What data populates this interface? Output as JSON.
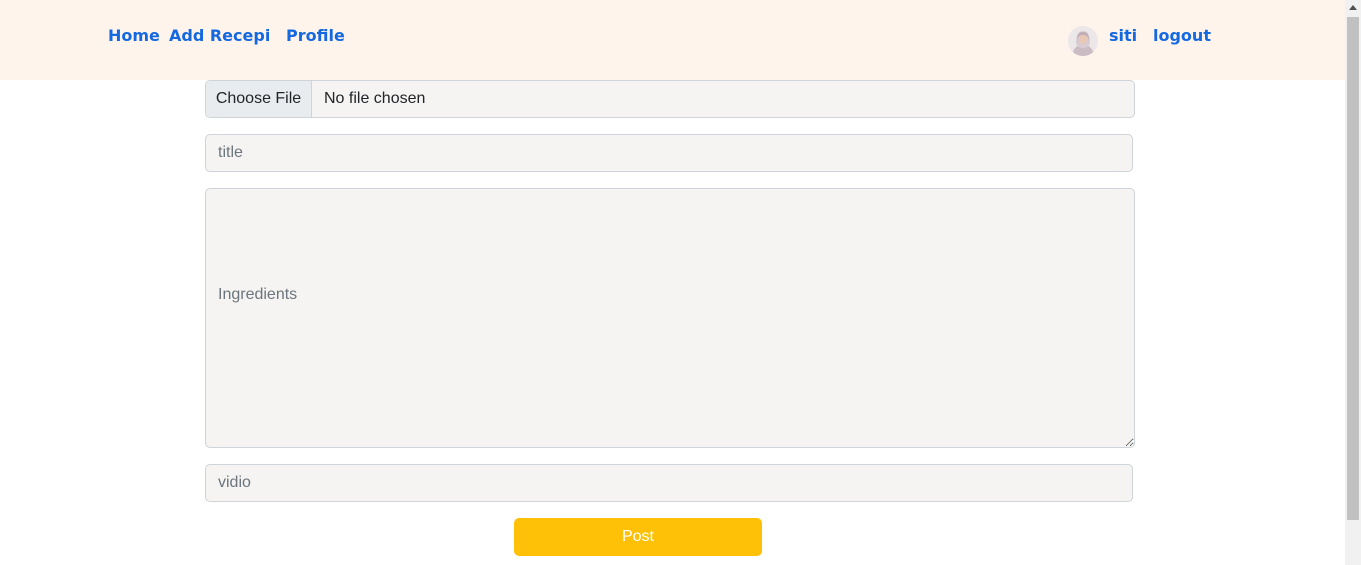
{
  "navbar": {
    "home_label": "Home",
    "add_recipe_label": "Add Recepi",
    "profile_label": "Profile",
    "username": "siti",
    "logout_label": "logout",
    "avatar_icon": "user-avatar-photo"
  },
  "form": {
    "file_button_label": "Choose File",
    "file_status": "No file chosen",
    "title_placeholder": "title",
    "ingredients_placeholder": "Ingredients",
    "video_placeholder": "vidio",
    "post_label": "Post"
  },
  "colors": {
    "navbar_bg": "#fff4ec",
    "link": "#1468e0",
    "field_bg": "#f5f4f2",
    "post_button": "#ffc107"
  }
}
